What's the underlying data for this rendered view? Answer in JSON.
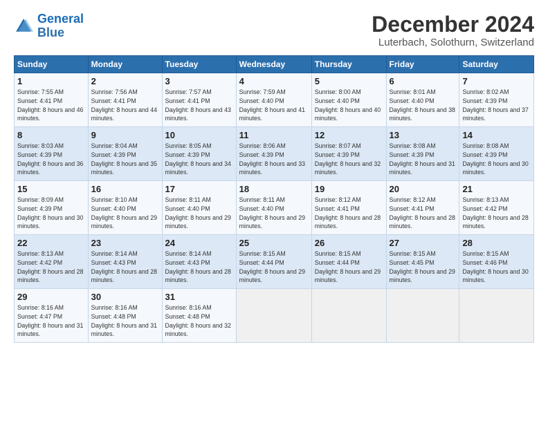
{
  "logo": {
    "line1": "General",
    "line2": "Blue"
  },
  "title": "December 2024",
  "subtitle": "Luterbach, Solothurn, Switzerland",
  "weekdays": [
    "Sunday",
    "Monday",
    "Tuesday",
    "Wednesday",
    "Thursday",
    "Friday",
    "Saturday"
  ],
  "weeks": [
    [
      {
        "day": "1",
        "rise": "7:55 AM",
        "set": "4:41 PM",
        "daylight": "8 hours and 46 minutes."
      },
      {
        "day": "2",
        "rise": "7:56 AM",
        "set": "4:41 PM",
        "daylight": "8 hours and 44 minutes."
      },
      {
        "day": "3",
        "rise": "7:57 AM",
        "set": "4:41 PM",
        "daylight": "8 hours and 43 minutes."
      },
      {
        "day": "4",
        "rise": "7:59 AM",
        "set": "4:40 PM",
        "daylight": "8 hours and 41 minutes."
      },
      {
        "day": "5",
        "rise": "8:00 AM",
        "set": "4:40 PM",
        "daylight": "8 hours and 40 minutes."
      },
      {
        "day": "6",
        "rise": "8:01 AM",
        "set": "4:40 PM",
        "daylight": "8 hours and 38 minutes."
      },
      {
        "day": "7",
        "rise": "8:02 AM",
        "set": "4:39 PM",
        "daylight": "8 hours and 37 minutes."
      }
    ],
    [
      {
        "day": "8",
        "rise": "8:03 AM",
        "set": "4:39 PM",
        "daylight": "8 hours and 36 minutes."
      },
      {
        "day": "9",
        "rise": "8:04 AM",
        "set": "4:39 PM",
        "daylight": "8 hours and 35 minutes."
      },
      {
        "day": "10",
        "rise": "8:05 AM",
        "set": "4:39 PM",
        "daylight": "8 hours and 34 minutes."
      },
      {
        "day": "11",
        "rise": "8:06 AM",
        "set": "4:39 PM",
        "daylight": "8 hours and 33 minutes."
      },
      {
        "day": "12",
        "rise": "8:07 AM",
        "set": "4:39 PM",
        "daylight": "8 hours and 32 minutes."
      },
      {
        "day": "13",
        "rise": "8:08 AM",
        "set": "4:39 PM",
        "daylight": "8 hours and 31 minutes."
      },
      {
        "day": "14",
        "rise": "8:08 AM",
        "set": "4:39 PM",
        "daylight": "8 hours and 30 minutes."
      }
    ],
    [
      {
        "day": "15",
        "rise": "8:09 AM",
        "set": "4:39 PM",
        "daylight": "8 hours and 30 minutes."
      },
      {
        "day": "16",
        "rise": "8:10 AM",
        "set": "4:40 PM",
        "daylight": "8 hours and 29 minutes."
      },
      {
        "day": "17",
        "rise": "8:11 AM",
        "set": "4:40 PM",
        "daylight": "8 hours and 29 minutes."
      },
      {
        "day": "18",
        "rise": "8:11 AM",
        "set": "4:40 PM",
        "daylight": "8 hours and 29 minutes."
      },
      {
        "day": "19",
        "rise": "8:12 AM",
        "set": "4:41 PM",
        "daylight": "8 hours and 28 minutes."
      },
      {
        "day": "20",
        "rise": "8:12 AM",
        "set": "4:41 PM",
        "daylight": "8 hours and 28 minutes."
      },
      {
        "day": "21",
        "rise": "8:13 AM",
        "set": "4:42 PM",
        "daylight": "8 hours and 28 minutes."
      }
    ],
    [
      {
        "day": "22",
        "rise": "8:13 AM",
        "set": "4:42 PM",
        "daylight": "8 hours and 28 minutes."
      },
      {
        "day": "23",
        "rise": "8:14 AM",
        "set": "4:43 PM",
        "daylight": "8 hours and 28 minutes."
      },
      {
        "day": "24",
        "rise": "8:14 AM",
        "set": "4:43 PM",
        "daylight": "8 hours and 28 minutes."
      },
      {
        "day": "25",
        "rise": "8:15 AM",
        "set": "4:44 PM",
        "daylight": "8 hours and 29 minutes."
      },
      {
        "day": "26",
        "rise": "8:15 AM",
        "set": "4:44 PM",
        "daylight": "8 hours and 29 minutes."
      },
      {
        "day": "27",
        "rise": "8:15 AM",
        "set": "4:45 PM",
        "daylight": "8 hours and 29 minutes."
      },
      {
        "day": "28",
        "rise": "8:15 AM",
        "set": "4:46 PM",
        "daylight": "8 hours and 30 minutes."
      }
    ],
    [
      {
        "day": "29",
        "rise": "8:16 AM",
        "set": "4:47 PM",
        "daylight": "8 hours and 31 minutes."
      },
      {
        "day": "30",
        "rise": "8:16 AM",
        "set": "4:48 PM",
        "daylight": "8 hours and 31 minutes."
      },
      {
        "day": "31",
        "rise": "8:16 AM",
        "set": "4:48 PM",
        "daylight": "8 hours and 32 minutes."
      },
      null,
      null,
      null,
      null
    ]
  ],
  "labels": {
    "sunrise": "Sunrise:",
    "sunset": "Sunset:",
    "daylight": "Daylight:"
  }
}
